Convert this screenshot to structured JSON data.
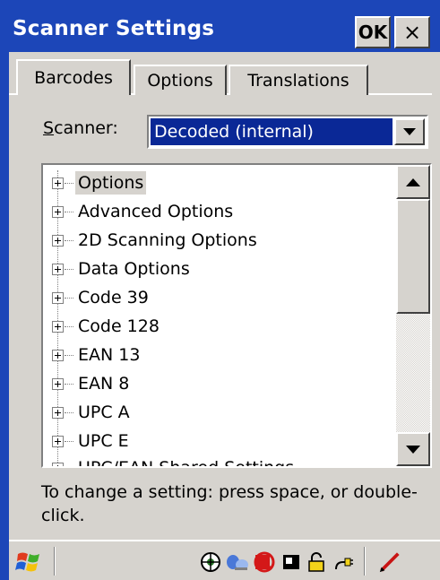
{
  "window": {
    "title": "Scanner Settings",
    "ok_label": "OK",
    "close_label": "×"
  },
  "tabs": [
    {
      "label": "Barcodes",
      "active": true
    },
    {
      "label": "Options",
      "active": false
    },
    {
      "label": "Translations",
      "active": false
    }
  ],
  "scanner": {
    "label_prefix": "S",
    "label_rest": "canner:",
    "value": "Decoded (internal)"
  },
  "tree": {
    "items": [
      {
        "label": "Options",
        "selected": true
      },
      {
        "label": "Advanced Options"
      },
      {
        "label": "2D Scanning Options"
      },
      {
        "label": "Data Options"
      },
      {
        "label": "Code 39"
      },
      {
        "label": "Code 128"
      },
      {
        "label": "EAN 13"
      },
      {
        "label": "EAN 8"
      },
      {
        "label": "UPC A"
      },
      {
        "label": "UPC E"
      },
      {
        "label": "UPC/EAN Shared Settings"
      }
    ]
  },
  "hint": "To change a setting: press space, or double-click.",
  "taskbar": {
    "tray_icons": [
      "network-icon",
      "sync-icon",
      "no-connection-icon",
      "battery-card-icon",
      "lock-icon",
      "power-plug-icon",
      "pen-icon"
    ]
  },
  "colors": {
    "titlebar": "#1c46b8",
    "selection": "#0a2896",
    "face": "#d6d3ce"
  }
}
